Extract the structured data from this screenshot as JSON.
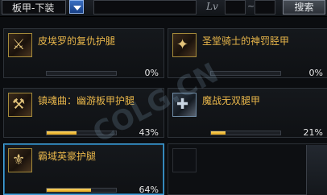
{
  "filters": {
    "category_value": "板甲-下装",
    "lv_label": "Lv",
    "tilde": "~",
    "search_label": "搜索"
  },
  "items": [
    {
      "name": "皮埃罗的复仇护腿",
      "percent": "0%",
      "progress": 0
    },
    {
      "name": "圣堂骑士的神罚胫甲",
      "percent": "0%",
      "progress": 0
    },
    {
      "name": "镇魂曲：幽游板甲护腿",
      "percent": "43%",
      "progress": 43
    },
    {
      "name": "魔战无双腿甲",
      "percent": "21%",
      "progress": 21
    },
    {
      "name": "霸域英豪护腿",
      "percent": "64%",
      "progress": 64
    }
  ],
  "watermark": "COLG.CN",
  "colors": {
    "name_gold": "#e8b64a",
    "bar_gold": "#f0b628",
    "selected_border": "#4aa3d9",
    "search_button": "#474d55"
  }
}
